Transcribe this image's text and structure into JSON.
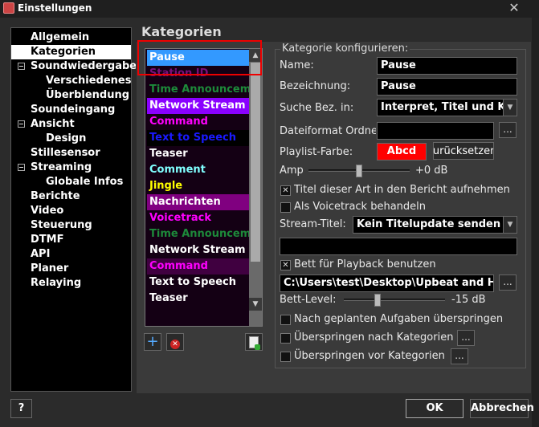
{
  "window": {
    "title": "Einstellungen",
    "close_glyph": "✕"
  },
  "sidebar": {
    "items": [
      {
        "label": "Allgemein",
        "level": 0,
        "expander": false,
        "selected": false
      },
      {
        "label": "Kategorien",
        "level": 0,
        "expander": false,
        "selected": true
      },
      {
        "label": "Soundwiedergabe",
        "level": 0,
        "expander": true,
        "selected": false
      },
      {
        "label": "Verschiedenes",
        "level": 1,
        "expander": false,
        "selected": false
      },
      {
        "label": "Überblendung",
        "level": 1,
        "expander": false,
        "selected": false
      },
      {
        "label": "Soundeingang",
        "level": 0,
        "expander": false,
        "selected": false
      },
      {
        "label": "Ansicht",
        "level": 0,
        "expander": true,
        "selected": false
      },
      {
        "label": "Design",
        "level": 1,
        "expander": false,
        "selected": false
      },
      {
        "label": "Stillesensor",
        "level": 0,
        "expander": false,
        "selected": false
      },
      {
        "label": "Streaming",
        "level": 0,
        "expander": true,
        "selected": false
      },
      {
        "label": "Globale Infos",
        "level": 1,
        "expander": false,
        "selected": false
      },
      {
        "label": "Berichte",
        "level": 0,
        "expander": false,
        "selected": false
      },
      {
        "label": "Video",
        "level": 0,
        "expander": false,
        "selected": false
      },
      {
        "label": "Steuerung",
        "level": 0,
        "expander": false,
        "selected": false
      },
      {
        "label": "DTMF",
        "level": 0,
        "expander": false,
        "selected": false
      },
      {
        "label": "API",
        "level": 0,
        "expander": false,
        "selected": false
      },
      {
        "label": "Planer",
        "level": 0,
        "expander": false,
        "selected": false
      },
      {
        "label": "Relaying",
        "level": 0,
        "expander": false,
        "selected": false
      }
    ]
  },
  "page": {
    "title": "Kategorien"
  },
  "categories": [
    {
      "label": "Pause",
      "fg": "#ffffff",
      "bg": "#3399ff",
      "selected": true
    },
    {
      "label": "Station ID",
      "fg": "#7a0f7a",
      "bg": "#140014",
      "selected": false
    },
    {
      "label": "Time Announcement",
      "fg": "#1d8a3a",
      "bg": "#140014",
      "selected": false
    },
    {
      "label": "Network Stream",
      "fg": "#ffffff",
      "bg": "#8a00ff",
      "selected": false
    },
    {
      "label": "Command",
      "fg": "#ff00ff",
      "bg": "#140014",
      "selected": false
    },
    {
      "label": "Text to Speech",
      "fg": "#1a1aff",
      "bg": "#000000",
      "selected": false
    },
    {
      "label": "Teaser",
      "fg": "#ffffff",
      "bg": "#140014",
      "selected": false
    },
    {
      "label": "Comment",
      "fg": "#80ffff",
      "bg": "#140014",
      "selected": false
    },
    {
      "label": "Jingle",
      "fg": "#ffff00",
      "bg": "#140014",
      "selected": false
    },
    {
      "label": "Nachrichten",
      "fg": "#ffffff",
      "bg": "#800080",
      "selected": false
    },
    {
      "label": "Voicetrack",
      "fg": "#ff00ff",
      "bg": "#140014",
      "selected": false
    },
    {
      "label": "Time Announcement",
      "fg": "#1d8a3a",
      "bg": "#140014",
      "selected": false
    },
    {
      "label": "Network Stream",
      "fg": "#ffffff",
      "bg": "#140014",
      "selected": false
    },
    {
      "label": "Command",
      "fg": "#ff00ff",
      "bg": "#400040",
      "selected": false
    },
    {
      "label": "Text to Speech",
      "fg": "#ffffff",
      "bg": "#140014",
      "selected": false
    },
    {
      "label": "Teaser",
      "fg": "#ffffff",
      "bg": "#140014",
      "selected": false
    }
  ],
  "list_icons": {
    "add": "plus-icon",
    "remove": "remove-icon",
    "export": "document-icon"
  },
  "config": {
    "legend": "Kategorie konfigurieren:",
    "name_label": "Name:",
    "name_value": "Pause",
    "bezeichnung_label": "Bezeichnung:",
    "bezeichnung_value": "Pause",
    "suche_label": "Suche Bez. in:",
    "suche_value": "Interpret, Titel und Kategorie",
    "dateiformat_label": "Dateiformat Ordner:",
    "dateiformat_value": "",
    "farbe_label": "Playlist-Farbe:",
    "farbe_sample": "Abcd",
    "farbe_color": "#ff0000",
    "reset_label": "Zurücksetzen",
    "amp_label": "Amp",
    "amp_value": "+0 dB",
    "amp_level": 0.5,
    "report_label": "Titel dieser Art in den Bericht aufnehmen",
    "report_checked": true,
    "voicetrack_label": "Als Voicetrack behandeln",
    "voicetrack_checked": false,
    "stream_label": "Stream-Titel:",
    "stream_value": "Kein Titelupdate senden",
    "stream_text": "",
    "bed_label": "Bett für Playback benutzen",
    "bed_checked": true,
    "bed_path": "C:\\Users\\test\\Desktop\\Upbeat and Happy",
    "bed_level_label": "Bett-Level:",
    "bed_level_value": "-15 dB",
    "bed_level": 0.32,
    "skip_planned_label": "Nach geplanten Aufgaben überspringen",
    "skip_planned_checked": false,
    "skip_after_label": "Überspringen nach Kategorien",
    "skip_after_checked": false,
    "skip_before_label": "Überspringen vor Kategorien",
    "skip_before_checked": false,
    "dots": "..."
  },
  "footer": {
    "help_label": "?",
    "ok_label": "OK",
    "cancel_label": "Abbrechen"
  }
}
